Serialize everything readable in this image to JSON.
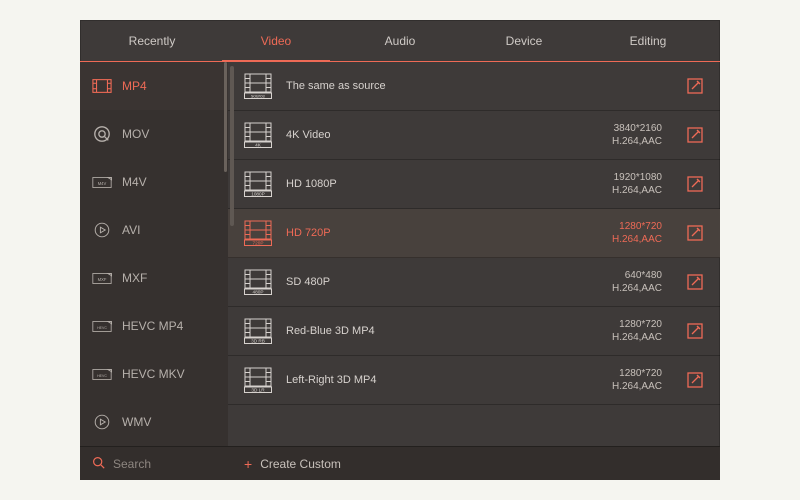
{
  "tabs": [
    "Recently",
    "Video",
    "Audio",
    "Device",
    "Editing"
  ],
  "active_tab": 1,
  "sidebar": {
    "items": [
      {
        "label": "MP4",
        "icon": "film"
      },
      {
        "label": "MOV",
        "icon": "q"
      },
      {
        "label": "M4V",
        "icon": "fmt-m4v"
      },
      {
        "label": "AVI",
        "icon": "play"
      },
      {
        "label": "MXF",
        "icon": "fmt-mxf"
      },
      {
        "label": "HEVC MP4",
        "icon": "fmt-hevc"
      },
      {
        "label": "HEVC MKV",
        "icon": "fmt-hevc"
      },
      {
        "label": "WMV",
        "icon": "play"
      }
    ],
    "active": 0
  },
  "presets": [
    {
      "badge": "source",
      "name": "The same as source",
      "res": "",
      "codec": ""
    },
    {
      "badge": "4K",
      "name": "4K Video",
      "res": "3840*2160",
      "codec": "H.264,AAC"
    },
    {
      "badge": "1080P",
      "name": "HD 1080P",
      "res": "1920*1080",
      "codec": "H.264,AAC"
    },
    {
      "badge": "720P",
      "name": "HD 720P",
      "res": "1280*720",
      "codec": "H.264,AAC"
    },
    {
      "badge": "480P",
      "name": "SD 480P",
      "res": "640*480",
      "codec": "H.264,AAC"
    },
    {
      "badge": "3D RB",
      "name": "Red-Blue 3D MP4",
      "res": "1280*720",
      "codec": "H.264,AAC"
    },
    {
      "badge": "3D LR",
      "name": "Left-Right 3D MP4",
      "res": "1280*720",
      "codec": "H.264,AAC"
    }
  ],
  "selected_preset": 3,
  "search": {
    "placeholder": "Search"
  },
  "create_custom_label": "Create Custom",
  "colors": {
    "accent": "#ee6a56"
  }
}
